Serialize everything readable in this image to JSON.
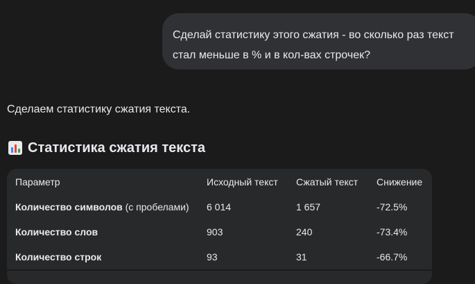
{
  "user_message": {
    "line1": "Сделай статистику этого сжатия - во сколько раз текст",
    "line2": "стал меньше в % и в кол-вах строчек?"
  },
  "response": {
    "intro": "Сделаем статистику сжатия текста.",
    "heading": {
      "icon": "bar-chart-icon",
      "title": "Статистика сжатия текста"
    },
    "table": {
      "headers": [
        "Параметр",
        "Исходный текст",
        "Сжатый текст",
        "Снижение"
      ],
      "rows": [
        {
          "param_bold": "Количество символов",
          "param_suffix": " (с пробелами)",
          "original": "6 014",
          "compressed": "1 657",
          "reduction": "-72.5%"
        },
        {
          "param_bold": "Количество слов",
          "param_suffix": "",
          "original": "903",
          "compressed": "240",
          "reduction": "-73.4%"
        },
        {
          "param_bold": "Количество строк",
          "param_suffix": "",
          "original": "93",
          "compressed": "31",
          "reduction": "-66.7%"
        }
      ]
    }
  },
  "colors": {
    "background": "#1b1b1c",
    "bubble": "#303134",
    "table": "#28292b",
    "text": "#e8eaed",
    "icon_bars": [
      "#4285f4",
      "#ea4335",
      "#34a853"
    ]
  }
}
